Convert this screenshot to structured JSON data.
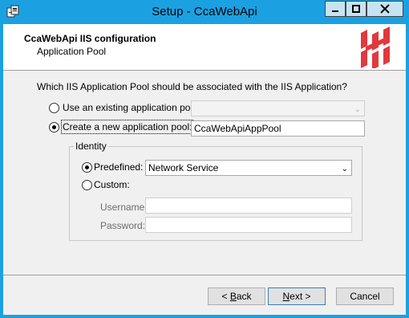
{
  "window": {
    "title": "Setup - CcaWebApi"
  },
  "banner": {
    "title": "CcaWebApi IIS configuration",
    "subtitle": "Application Pool"
  },
  "form": {
    "question": "Which IIS Application Pool should be associated with the IIS Application?",
    "existing_pool_label": "Use an existing application pool:",
    "existing_pool_value": "",
    "existing_pool_selected": false,
    "new_pool_label": "Create a new application pool:",
    "new_pool_value": "CcaWebApiAppPool",
    "new_pool_selected": true
  },
  "identity": {
    "legend": "Identity",
    "predefined_label": "Predefined:",
    "predefined_selected": true,
    "predefined_value": "Network Service",
    "custom_label": "Custom:",
    "custom_selected": false,
    "username_label": "Username:",
    "username_value": "",
    "password_label": "Password:",
    "password_value": ""
  },
  "buttons": {
    "back_prefix": "< ",
    "back_mnemonic": "B",
    "back_rest": "ack",
    "next_mnemonic": "N",
    "next_rest": "ext >",
    "cancel": "Cancel"
  },
  "colors": {
    "titlebar": "#1ba1e2",
    "logo_red": "#e0393e"
  }
}
